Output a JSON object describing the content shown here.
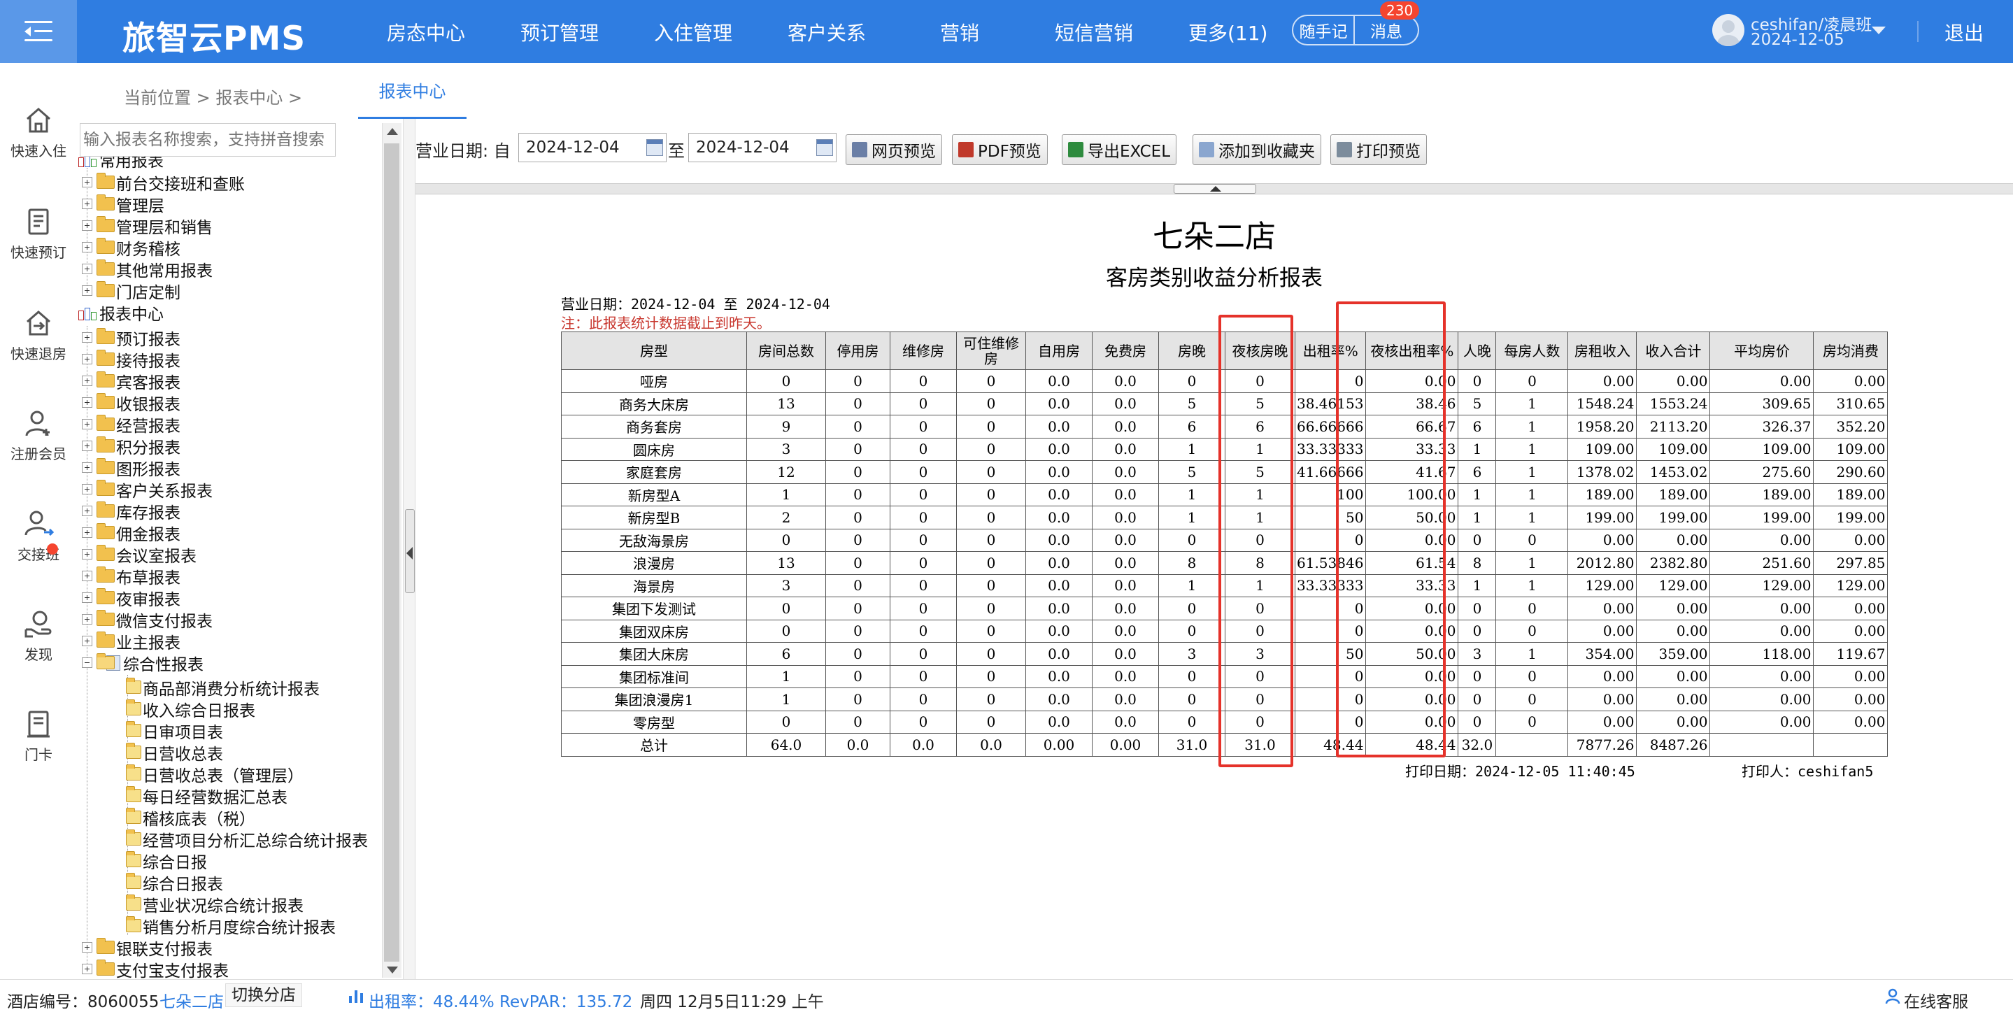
{
  "app": {
    "title": "旅智云PMS"
  },
  "nav": [
    "房态中心",
    "预订管理",
    "入住管理",
    "客户关系",
    "营销",
    "短信营销",
    "更多(11)"
  ],
  "header": {
    "quick_note": "随手记",
    "messages": "消息",
    "message_count": "230",
    "user": "ceshifan/凌晨班",
    "date": "2024-12-05",
    "logout": "退出"
  },
  "rail": [
    "快速入住",
    "快速预订",
    "快速退房",
    "注册会员",
    "交接班",
    "发现",
    "门卡"
  ],
  "breadcrumb": {
    "text": "当前位置  >  报表中心  >",
    "tab": "报表中心"
  },
  "tree": {
    "search_placeholder": "输入报表名称搜索，支持拼音搜索",
    "groups1_root": "常用报表",
    "groups1": [
      "前台交接班和查账",
      "管理层",
      "管理层和销售",
      "财务稽核",
      "其他常用报表",
      "门店定制"
    ],
    "groups2_root": "报表中心",
    "groups2": [
      "预订报表",
      "接待报表",
      "宾客报表",
      "收银报表",
      "经营报表",
      "积分报表",
      "图形报表",
      "客户关系报表",
      "库存报表",
      "佣金报表",
      "会议室报表",
      "布草报表",
      "夜审报表",
      "微信支付报表",
      "业主报表"
    ],
    "open_group": "综合性报表",
    "open_items": [
      "商品部消费分析统计报表",
      "收入综合日报表",
      "日审项目表",
      "日营收总表",
      "日营收总表（管理层）",
      "每日经营数据汇总表",
      "稽核底表（税）",
      "经营项目分析汇总综合统计报表",
      "综合日报",
      "综合日报表",
      "营业状况综合统计报表",
      "销售分析月度综合统计报表"
    ],
    "tail_groups": [
      "银联支付报表",
      "支付宝支付报表"
    ]
  },
  "toolbar": {
    "date_label": "营业日期: 自",
    "from": "2024-12-04",
    "to_label": "至",
    "to": "2024-12-04",
    "buttons": [
      "网页预览",
      "PDF预览",
      "导出EXCEL",
      "添加到收藏夹",
      "打印预览"
    ]
  },
  "report": {
    "hotel": "七朵二店",
    "title": "客房类别收益分析报表",
    "date_line": "营业日期：2024-12-04 至 2024-12-04",
    "note": "注：此报表统计数据截止到昨天。",
    "columns": [
      "房型",
      "房间总数",
      "停用房",
      "维修房",
      "可住维修房",
      "自用房",
      "免费房",
      "房晚",
      "夜核房晚",
      "出租率%",
      "夜核出租率%",
      "人晚",
      "每房人数",
      "房租收入",
      "收入合计",
      "平均房价",
      "房均消费"
    ],
    "rows": [
      [
        "哑房",
        "0",
        "0",
        "0",
        "0",
        "0.0",
        "0.0",
        "0",
        "0",
        "0",
        "0.00",
        "0",
        "0",
        "0.00",
        "0.00",
        "0.00",
        "0.00"
      ],
      [
        "商务大床房",
        "13",
        "0",
        "0",
        "0",
        "0.0",
        "0.0",
        "5",
        "5",
        "38.46153",
        "38.46",
        "5",
        "1",
        "1548.24",
        "1553.24",
        "309.65",
        "310.65"
      ],
      [
        "商务套房",
        "9",
        "0",
        "0",
        "0",
        "0.0",
        "0.0",
        "6",
        "6",
        "66.66666",
        "66.67",
        "6",
        "1",
        "1958.20",
        "2113.20",
        "326.37",
        "352.20"
      ],
      [
        "圆床房",
        "3",
        "0",
        "0",
        "0",
        "0.0",
        "0.0",
        "1",
        "1",
        "33.33333",
        "33.33",
        "1",
        "1",
        "109.00",
        "109.00",
        "109.00",
        "109.00"
      ],
      [
        "家庭套房",
        "12",
        "0",
        "0",
        "0",
        "0.0",
        "0.0",
        "5",
        "5",
        "41.66666",
        "41.67",
        "6",
        "1",
        "1378.02",
        "1453.02",
        "275.60",
        "290.60"
      ],
      [
        "新房型A",
        "1",
        "0",
        "0",
        "0",
        "0.0",
        "0.0",
        "1",
        "1",
        "100",
        "100.00",
        "1",
        "1",
        "189.00",
        "189.00",
        "189.00",
        "189.00"
      ],
      [
        "新房型B",
        "2",
        "0",
        "0",
        "0",
        "0.0",
        "0.0",
        "1",
        "1",
        "50",
        "50.00",
        "1",
        "1",
        "199.00",
        "199.00",
        "199.00",
        "199.00"
      ],
      [
        "无敌海景房",
        "0",
        "0",
        "0",
        "0",
        "0.0",
        "0.0",
        "0",
        "0",
        "0",
        "0.00",
        "0",
        "0",
        "0.00",
        "0.00",
        "0.00",
        "0.00"
      ],
      [
        "浪漫房",
        "13",
        "0",
        "0",
        "0",
        "0.0",
        "0.0",
        "8",
        "8",
        "61.53846",
        "61.54",
        "8",
        "1",
        "2012.80",
        "2382.80",
        "251.60",
        "297.85"
      ],
      [
        "海景房",
        "3",
        "0",
        "0",
        "0",
        "0.0",
        "0.0",
        "1",
        "1",
        "33.33333",
        "33.33",
        "1",
        "1",
        "129.00",
        "129.00",
        "129.00",
        "129.00"
      ],
      [
        "集团下发测试",
        "0",
        "0",
        "0",
        "0",
        "0.0",
        "0.0",
        "0",
        "0",
        "0",
        "0.00",
        "0",
        "0",
        "0.00",
        "0.00",
        "0.00",
        "0.00"
      ],
      [
        "集团双床房",
        "0",
        "0",
        "0",
        "0",
        "0.0",
        "0.0",
        "0",
        "0",
        "0",
        "0.00",
        "0",
        "0",
        "0.00",
        "0.00",
        "0.00",
        "0.00"
      ],
      [
        "集团大床房",
        "6",
        "0",
        "0",
        "0",
        "0.0",
        "0.0",
        "3",
        "3",
        "50",
        "50.00",
        "3",
        "1",
        "354.00",
        "359.00",
        "118.00",
        "119.67"
      ],
      [
        "集团标准间",
        "1",
        "0",
        "0",
        "0",
        "0.0",
        "0.0",
        "0",
        "0",
        "0",
        "0.00",
        "0",
        "0",
        "0.00",
        "0.00",
        "0.00",
        "0.00"
      ],
      [
        "集团浪漫房1",
        "1",
        "0",
        "0",
        "0",
        "0.0",
        "0.0",
        "0",
        "0",
        "0",
        "0.00",
        "0",
        "0",
        "0.00",
        "0.00",
        "0.00",
        "0.00"
      ],
      [
        "零房型",
        "0",
        "0",
        "0",
        "0",
        "0.0",
        "0.0",
        "0",
        "0",
        "0",
        "0.00",
        "0",
        "0",
        "0.00",
        "0.00",
        "0.00",
        "0.00"
      ]
    ],
    "total": [
      "总计",
      "64.0",
      "0.0",
      "0.0",
      "0.0",
      "0.00",
      "0.00",
      "31.0",
      "31.0",
      "48.44",
      "48.44",
      "32.0",
      "",
      "7877.26",
      "8487.26",
      "",
      ""
    ],
    "print_date": "打印日期：2024-12-05 11:40:45",
    "print_user": "打印人：ceshifan5"
  },
  "status": {
    "hotel_code": "酒店编号：8060055",
    "hotel_name": "七朵二店",
    "switch_branch": "切换分店",
    "occupancy": "出租率：48.44% RevPAR：135.72",
    "datetime": "周四 12月5日11:29 上午",
    "online_service": "在线客服"
  },
  "colors": {
    "primary": "#2f7de1",
    "highlight": "#e5322a",
    "note": "#c8362d"
  }
}
